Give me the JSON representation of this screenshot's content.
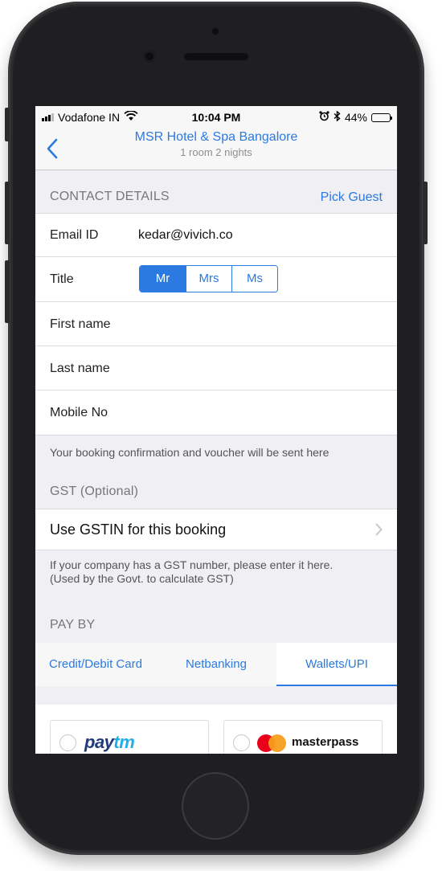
{
  "status_bar": {
    "carrier": "Vodafone IN",
    "time": "10:04 PM",
    "battery_percent": "44%",
    "battery_level": 0.44
  },
  "nav": {
    "title": "MSR Hotel & Spa Bangalore",
    "subtitle": "1 room 2 nights"
  },
  "contact": {
    "section_title": "CONTACT DETAILS",
    "pick_guest": "Pick Guest",
    "email_label": "Email ID",
    "email_value": "kedar@vivich.co",
    "title_label": "Title",
    "title_options": [
      "Mr",
      "Mrs",
      "Ms"
    ],
    "title_selected": "Mr",
    "first_name_label": "First name",
    "last_name_label": "Last name",
    "mobile_label": "Mobile No",
    "note": "Your booking confirmation and voucher will be sent here"
  },
  "gst": {
    "section_title": "GST (Optional)",
    "row_label": "Use GSTIN for this booking",
    "note_line1": "If your company has a GST number, please enter it here.",
    "note_line2": "(Used by the Govt. to calculate GST)"
  },
  "pay": {
    "section_title": "PAY BY",
    "tabs": [
      "Credit/Debit Card",
      "Netbanking",
      "Wallets/UPI"
    ],
    "active_tab": "Wallets/UPI",
    "wallets": {
      "paytm_pay": "pay",
      "paytm_tm": "tm",
      "masterpass": "masterpass"
    }
  },
  "colors": {
    "accent": "#2a7ae2",
    "background": "#efeff4",
    "phone_body": "#2b2b2d"
  }
}
